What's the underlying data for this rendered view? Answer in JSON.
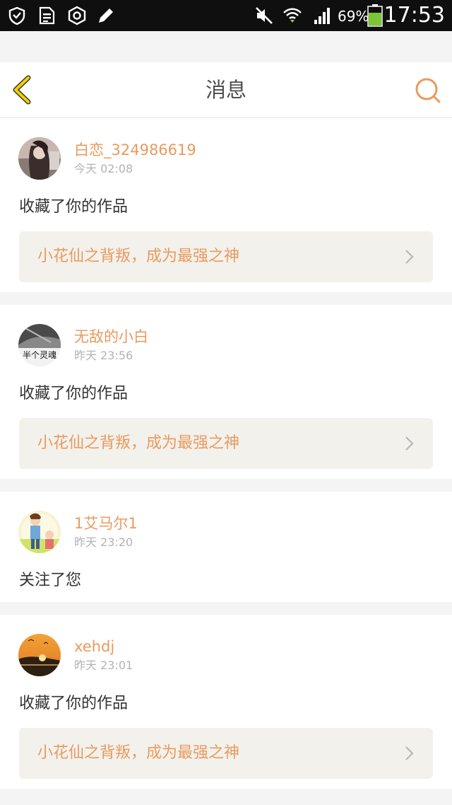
{
  "status_bar": {
    "battery": "69%",
    "time": "17:53"
  },
  "header": {
    "title": "消息",
    "icons": {
      "back": "back-chevron-icon",
      "search": "search-icon"
    }
  },
  "notifications": [
    {
      "username": "白恋_324986619",
      "time": "今天 02:08",
      "action": "收藏了你的作品",
      "work_title": "小花仙之背叛，成为最强之神",
      "avatar": "avatar-dark-figure"
    },
    {
      "username": "无敌的小白",
      "time": "昨天 23:56",
      "action": "收藏了你的作品",
      "work_title": "小花仙之背叛，成为最强之神",
      "avatar": "avatar-grayscale-text",
      "avatar_text": "半个灵魂"
    },
    {
      "username": "1艾马尔1",
      "time": "昨天 23:20",
      "action": "关注了您",
      "avatar": "avatar-cartoon-characters"
    },
    {
      "username": "xehdj",
      "time": "昨天 23:01",
      "action": "收藏了你的作品",
      "work_title": "小花仙之背叛，成为最强之神",
      "avatar": "avatar-sunset-landscape"
    }
  ],
  "colors": {
    "accent": "#ea9a5e",
    "back_icon": "#f2cf00",
    "box_background": "#f2f1ec",
    "page_background": "#f4f4f4"
  }
}
